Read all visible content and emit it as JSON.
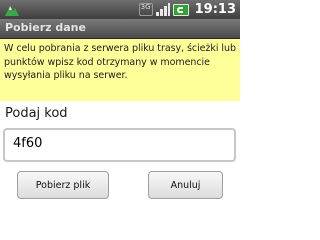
{
  "statusbar": {
    "time": "19:13",
    "network_label": "3G"
  },
  "dialog": {
    "title": "Pobierz dane",
    "info_text": "W celu pobrania z serwera pliku trasy, ścieżki lub punktów wpisz kod otrzymany w momencie wysyłania pliku na serwer.",
    "code_label": "Podaj kod",
    "code_value": "4f60",
    "download_label": "Pobierz plik",
    "cancel_label": "Anuluj"
  },
  "colors": {
    "info_background": "#ffff99",
    "battery": "#2fa52f"
  }
}
